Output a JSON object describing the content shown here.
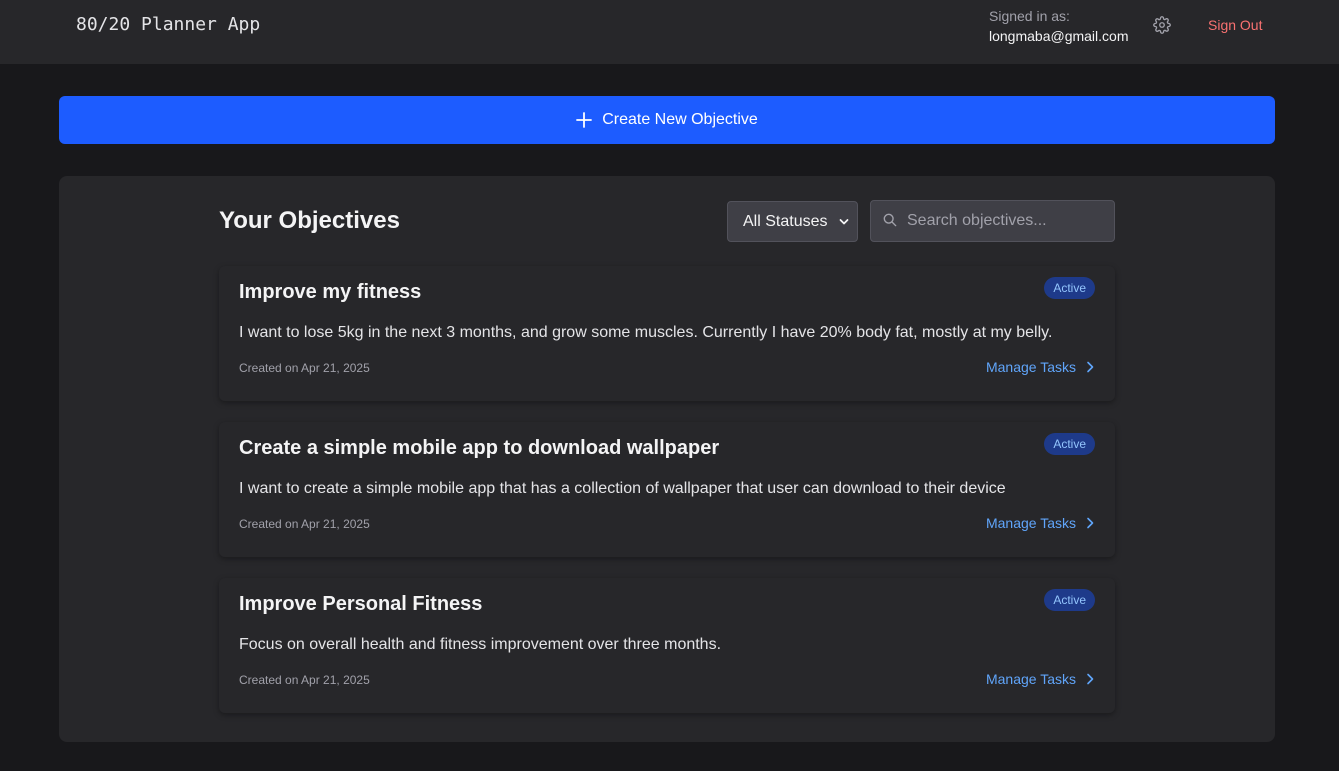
{
  "header": {
    "app_title": "80/20 Planner App",
    "signed_in_label": "Signed in as:",
    "email": "longmaba@gmail.com",
    "settings_icon": "gear-icon",
    "sign_out_label": "Sign Out"
  },
  "create_button": {
    "icon": "plus-icon",
    "label": "Create New Objective"
  },
  "objectives": {
    "title": "Your Objectives",
    "status_filter": {
      "selected": "All Statuses"
    },
    "search": {
      "placeholder": "Search objectives...",
      "value": "",
      "icon": "search-icon"
    },
    "items": [
      {
        "title": "Improve my fitness",
        "status": "Active",
        "description": "I want to lose 5kg in the next 3 months, and grow some muscles. Currently I have 20% body fat, mostly at my belly.",
        "created": "Created on Apr 21, 2025",
        "action": "Manage Tasks"
      },
      {
        "title": "Create a simple mobile app to download wallpaper",
        "status": "Active",
        "description": "I want to create a simple mobile app that has a collection of wallpaper that user can download to their device",
        "created": "Created on Apr 21, 2025",
        "action": "Manage Tasks"
      },
      {
        "title": "Improve Personal Fitness",
        "status": "Active",
        "description": "Focus on overall health and fitness improvement over three months.",
        "created": "Created on Apr 21, 2025",
        "action": "Manage Tasks"
      }
    ]
  },
  "colors": {
    "background": "#18181b",
    "surface": "#27272a",
    "primary": "#1d5cff",
    "link": "#60a5fa",
    "danger": "#f87171",
    "badge_bg": "#1e3a8a",
    "badge_text": "#93c5fd"
  }
}
